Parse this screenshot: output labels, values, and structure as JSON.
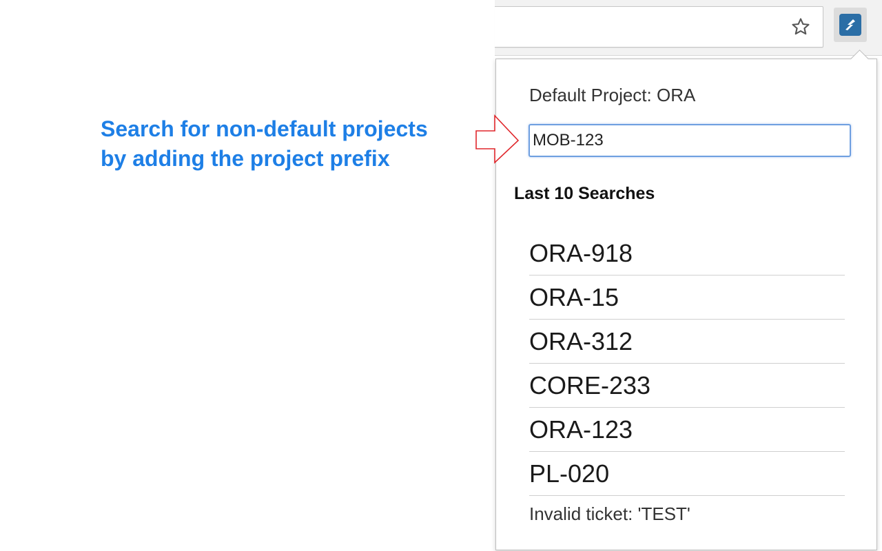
{
  "toolbar": {
    "icons": {
      "bookmark": "star-icon",
      "extension": "jira-extension-icon"
    }
  },
  "popup": {
    "default_project": "Default Project: ORA",
    "search_input_value": "MOB-123",
    "recent_heading": "Last 10 Searches",
    "recent_searches": [
      "ORA-918",
      "ORA-15",
      "ORA-312",
      "CORE-233",
      "ORA-123",
      "PL-020"
    ],
    "invalid_message": "Invalid ticket: 'TEST'"
  },
  "annotation": {
    "line1": "Search for non-default projects",
    "line2": "by adding the project prefix"
  },
  "colors": {
    "annotation": "#1e7fe6",
    "callout_arrow": "#e0262b",
    "extension_icon": "#2b6ea6",
    "input_focus": "#6e9fe0"
  }
}
